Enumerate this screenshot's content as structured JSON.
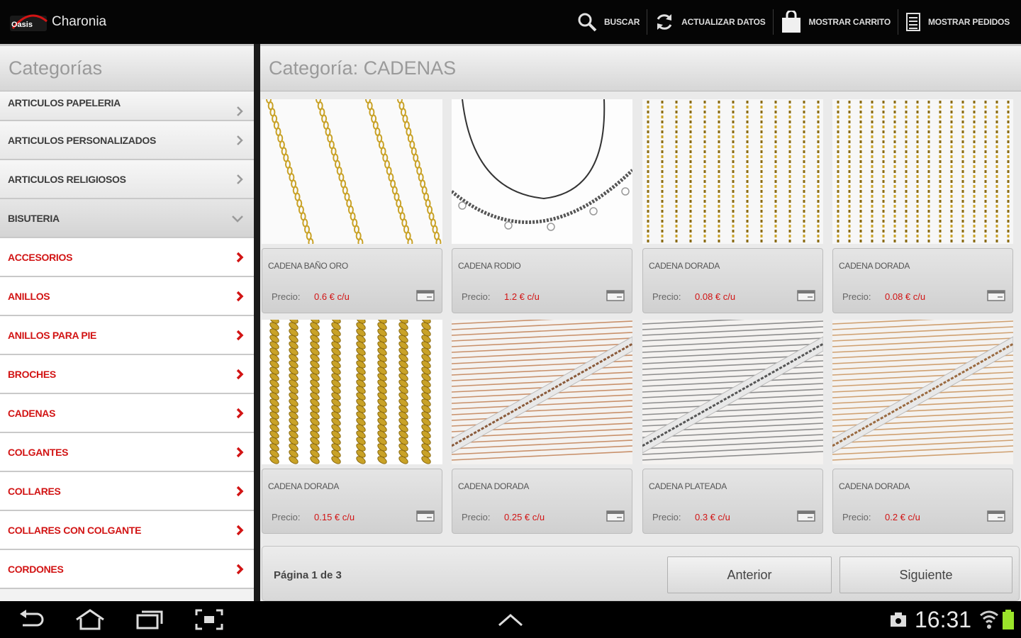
{
  "app": {
    "title": "Charonia",
    "logo_text": "Oasis"
  },
  "actions": [
    {
      "label": "BUSCAR",
      "icon": "search-icon"
    },
    {
      "label": "ACTUALIZAR DATOS",
      "icon": "refresh-icon"
    },
    {
      "label": "MOSTRAR CARRITO",
      "icon": "shopping-bag-icon"
    },
    {
      "label": "MOSTRAR PEDIDOS",
      "icon": "orders-list-icon"
    }
  ],
  "sidebar": {
    "header": "Categorías",
    "items": [
      {
        "label": "ARTICULOS PAPELERIA",
        "style": "gray"
      },
      {
        "label": "ARTICULOS PERSONALIZADOS",
        "style": "gray"
      },
      {
        "label": "ARTICULOS RELIGIOSOS",
        "style": "gray"
      },
      {
        "label": "BISUTERIA",
        "style": "open"
      },
      {
        "label": "ACCESORIOS",
        "style": "red"
      },
      {
        "label": "ANILLOS",
        "style": "red"
      },
      {
        "label": "ANILLOS PARA PIE",
        "style": "red"
      },
      {
        "label": "BROCHES",
        "style": "red"
      },
      {
        "label": "CADENAS",
        "style": "red"
      },
      {
        "label": "COLGANTES",
        "style": "red"
      },
      {
        "label": "COLLARES",
        "style": "red"
      },
      {
        "label": "COLLARES CON COLGANTE",
        "style": "red"
      },
      {
        "label": "CORDONES",
        "style": "red"
      }
    ]
  },
  "main": {
    "header": "Categoría: CADENAS",
    "price_label": "Precio:",
    "products": [
      {
        "name": "CADENA BAÑO ORO",
        "price": "0.6 € c/u",
        "photo": "gold-link-chains"
      },
      {
        "name": "CADENA RODIO",
        "price": "1.2 € c/u",
        "photo": "rhodium-chain-necklace"
      },
      {
        "name": "CADENA DORADA",
        "price": "0.08 € c/u",
        "photo": "gold-ball-chains"
      },
      {
        "name": "CADENA DORADA",
        "price": "0.08 € c/u",
        "photo": "gold-ball-chains-thin"
      },
      {
        "name": "CADENA DORADA",
        "price": "0.15 € c/u",
        "photo": "gold-rope-chains"
      },
      {
        "name": "CADENA DORADA",
        "price": "0.25 € c/u",
        "photo": "copper-chain-bundle"
      },
      {
        "name": "CADENA PLATEADA",
        "price": "0.3 € c/u",
        "photo": "silver-chain-bundle"
      },
      {
        "name": "CADENA DORADA",
        "price": "0.2 € c/u",
        "photo": "gold-chain-bundle"
      }
    ],
    "pager": {
      "text": "Página 1 de 3",
      "prev_label": "Anterior",
      "next_label": "Siguiente"
    }
  },
  "system": {
    "time": "16:31"
  },
  "colors": {
    "accent_red": "#d21414",
    "bar_black": "#050505",
    "gold": "#c9a227"
  }
}
